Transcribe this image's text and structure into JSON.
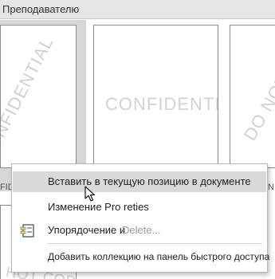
{
  "header": {
    "title": "Преподавателю"
  },
  "thumbnails": [
    {
      "watermark": "CONFIDENTIAL"
    },
    {
      "watermark": "CONFIDENTIAL"
    },
    {
      "watermark": "DO NOT"
    }
  ],
  "partial_labels": {
    "left": "FID",
    "right": "N",
    "bottom": "HOT COPY"
  },
  "context_menu": {
    "items": [
      {
        "label": "Вставить в текущую позицию в документе",
        "highlighted": true
      },
      {
        "label": "Изменение Pro reties"
      },
      {
        "label": "Упорядочение и",
        "trailing": "Delete..."
      },
      {
        "label": "Добавить коллекцию на панель быстрого доступа"
      }
    ]
  },
  "colors": {
    "header_bg": "#e6e6e6",
    "highlight": "#d9d9d9",
    "watermark": "#d2d2d2"
  }
}
